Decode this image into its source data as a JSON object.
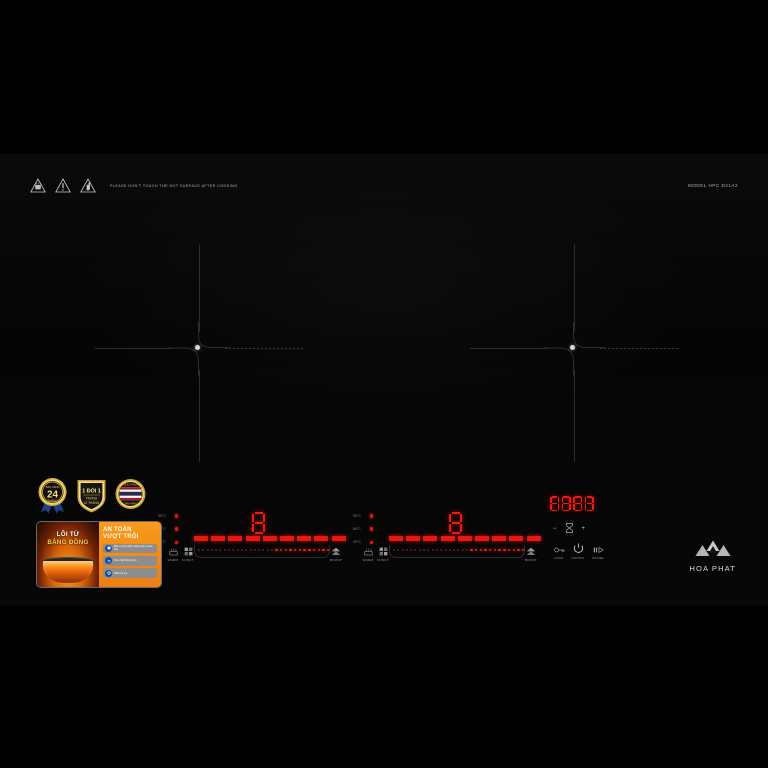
{
  "product": {
    "model_label": "MODEL HPC D21A2",
    "brand_name": "HOA PHAT",
    "warning_text": "PLEASE DON'T TOUCH THE HOT SURFACE AFTER COOKING"
  },
  "zones": [
    {
      "id": "left-zone",
      "display_value": "8",
      "temperature_presets": [
        {
          "label": "90°C",
          "active": true
        },
        {
          "label": "80°C",
          "active": true
        },
        {
          "label": "40°C",
          "active": true
        }
      ],
      "power_segments_total": 9,
      "power_segments_lit": 9,
      "slider_dots_total": 30,
      "slider_dots_lit": 12,
      "indicator_led": true,
      "buttons": [
        {
          "name": "warm",
          "label": "WARM",
          "icon": "warm-icon"
        },
        {
          "name": "function",
          "label": "FUNCT",
          "icon": "function-grid-icon"
        },
        {
          "name": "boost",
          "label": "BOOST",
          "icon": "boost-arrow-icon"
        }
      ]
    },
    {
      "id": "right-zone",
      "display_value": "8",
      "temperature_presets": [
        {
          "label": "90°C",
          "active": true
        },
        {
          "label": "80°C",
          "active": true
        },
        {
          "label": "40°C",
          "active": true
        }
      ],
      "power_segments_total": 9,
      "power_segments_lit": 9,
      "slider_dots_total": 30,
      "slider_dots_lit": 12,
      "indicator_led": true,
      "buttons": [
        {
          "name": "warm",
          "label": "WARM",
          "icon": "warm-icon"
        },
        {
          "name": "function",
          "label": "FUNCT",
          "icon": "function-grid-icon"
        },
        {
          "name": "boost",
          "label": "BOOST",
          "icon": "boost-arrow-icon"
        }
      ]
    }
  ],
  "timer": {
    "display_value": "8888",
    "decrease_label": "−",
    "increase_label": "+",
    "icon": "timer-icon"
  },
  "system_buttons": [
    {
      "name": "lock",
      "label": "LOCK",
      "icon": "key-lock-icon"
    },
    {
      "name": "on-off",
      "label": "ON/OFF",
      "icon": "power-icon"
    },
    {
      "name": "pause",
      "label": "PAUSE",
      "icon": "pause-icon"
    }
  ],
  "badges": [
    {
      "name": "warranty-24",
      "top_text": "BẢO HÀNH",
      "main_text": "24",
      "bottom_text": "THÁNG"
    },
    {
      "name": "one-to-one-exchange",
      "main_text": "1 ĐỔI 1",
      "sub_text": "TRONG",
      "bottom_text": "12 THÁNG"
    },
    {
      "name": "made-in-thailand",
      "top_text": "MADE IN THAILAND",
      "bottom_text": "CHÍNH HÃNG"
    }
  ],
  "promo_sticker": {
    "left_line1": "LÕI TỪ",
    "left_line2": "BẢNG ĐỒNG",
    "right_title1": "AN TOÀN",
    "right_title2": "VƯỢT TRỘI",
    "features": [
      {
        "icon": "shield-icon",
        "text": "Bảo vệ hợp nhất, chống dán an toàn cao"
      },
      {
        "icon": "fan-icon",
        "text": "Tản nhiệt thông minh"
      },
      {
        "icon": "gear-icon",
        "text": "Nhận trẻ em"
      }
    ]
  },
  "colors": {
    "led_red": "#e8180f",
    "glass_black": "#060606",
    "text_gray": "#b9b9b9",
    "gold": "#d4a82a"
  }
}
